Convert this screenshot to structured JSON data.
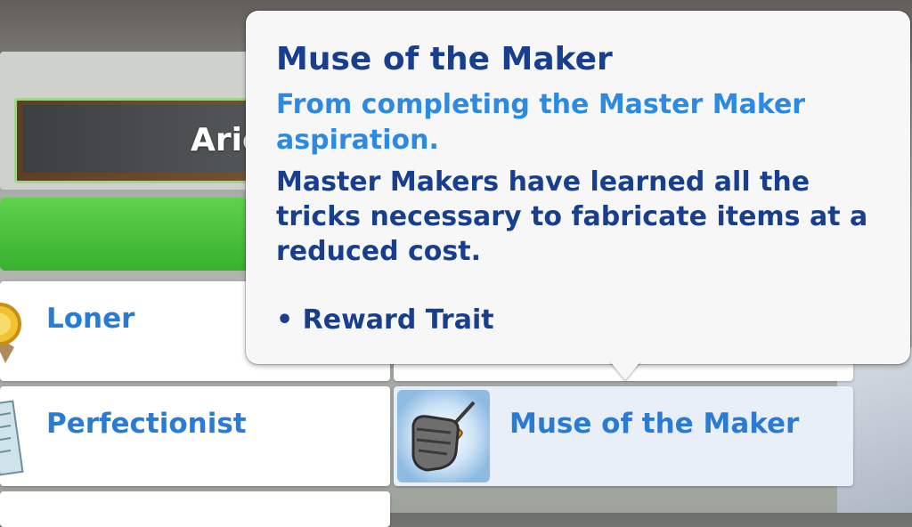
{
  "background": {
    "name_partial": "Arie"
  },
  "tooltip": {
    "title": "Muse of the Maker",
    "source": "From completing the Master Maker aspiration.",
    "description": "Master Makers have learned all the tricks necessary to fabricate items at a reduced cost.",
    "bullet": "• Reward Trait"
  },
  "traits": [
    {
      "label": "Loner",
      "icon": "gold-medal-icon"
    },
    {
      "label": "Perfectionist",
      "icon": "ruler-icon"
    },
    {
      "label": "Muse of the Maker",
      "icon": "fist-with-screwdriver-icon",
      "selected": true
    }
  ],
  "colors": {
    "title_dark_blue": "#183f8d",
    "source_light_blue": "#2c8ae2",
    "trait_label_blue": "#2a7bd3",
    "green_button": "#38b12f"
  }
}
